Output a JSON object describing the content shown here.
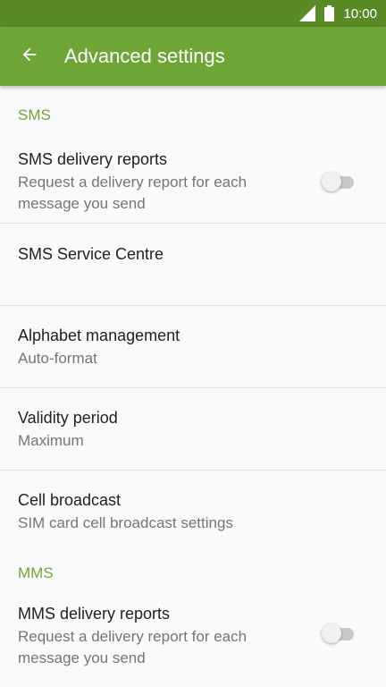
{
  "status_bar": {
    "time": "10:00",
    "icons": [
      "signal-icon",
      "battery-icon"
    ]
  },
  "app_bar": {
    "back_icon": "arrow-left-icon",
    "title": "Advanced settings"
  },
  "colors": {
    "status_bar": "#5a8a26",
    "app_bar": "#6ea537",
    "accent": "#6ea537",
    "background": "#fafafa"
  },
  "sections": {
    "sms": {
      "header": "SMS",
      "delivery_reports": {
        "title": "SMS delivery reports",
        "summary_line1": "Request a delivery report for each",
        "summary_line2": "message you send",
        "toggle_on": false
      },
      "service_centre": {
        "title": "SMS Service Centre"
      },
      "alphabet": {
        "title": "Alphabet management",
        "summary": "Auto-format"
      },
      "validity": {
        "title": "Validity period",
        "summary": "Maximum"
      },
      "cell_broadcast": {
        "title": "Cell broadcast",
        "summary": "SIM card cell broadcast settings"
      }
    },
    "mms": {
      "header": "MMS",
      "delivery_reports": {
        "title": "MMS delivery reports",
        "summary_line1": "Request a delivery report for each",
        "summary_line2": "message you send",
        "toggle_on": false
      }
    }
  }
}
